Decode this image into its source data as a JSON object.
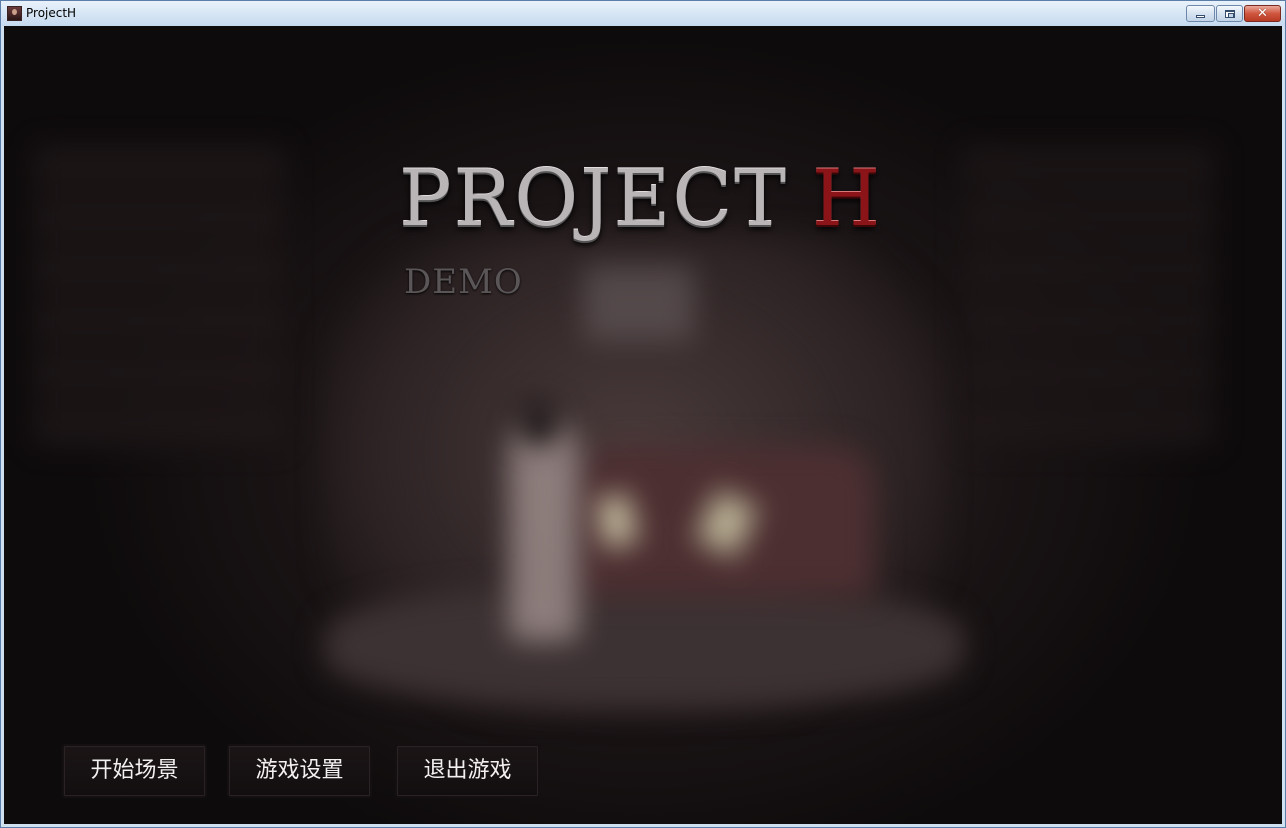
{
  "window": {
    "title": "ProjectH"
  },
  "logo": {
    "main": "PROJECT",
    "accent": "H",
    "subtitle": "DEMO",
    "main_color": "#b9b4b6",
    "accent_color": "#8b1418"
  },
  "menu": {
    "start_label": "开始场景",
    "settings_label": "游戏设置",
    "quit_label": "退出游戏"
  }
}
